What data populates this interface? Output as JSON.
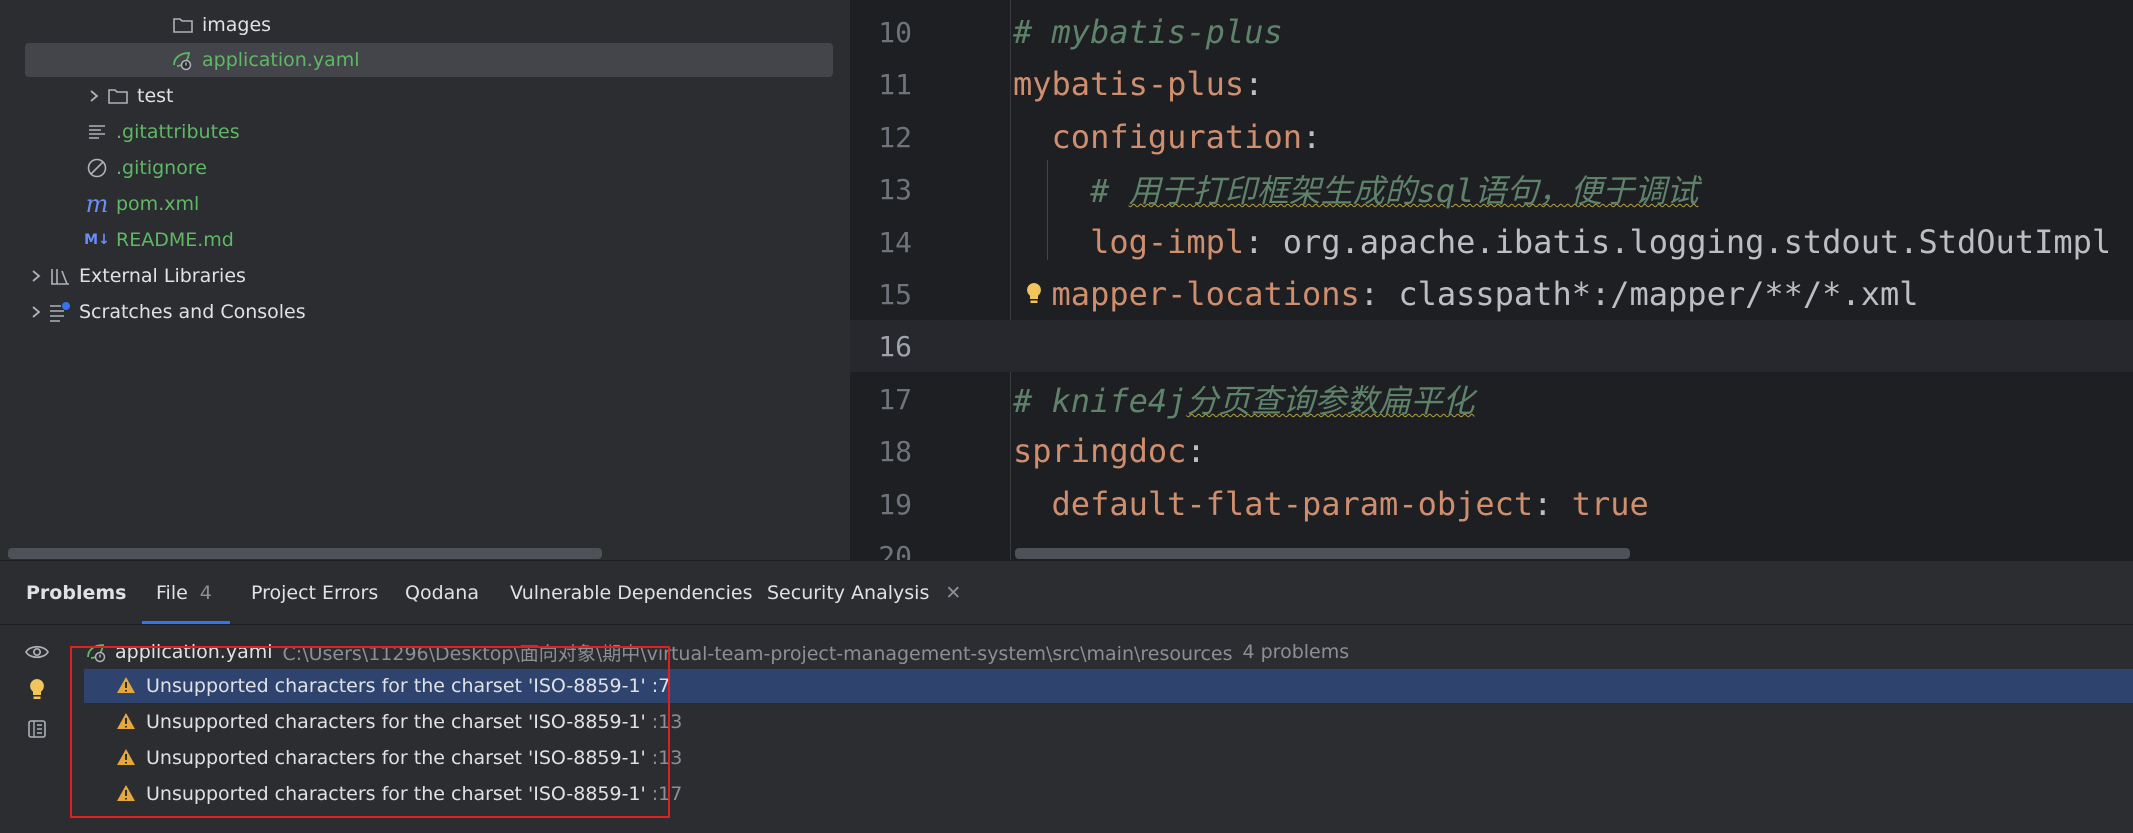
{
  "project_tree": {
    "items": [
      {
        "label": "images",
        "icon": "folder-icon",
        "color": "#dfe1e5"
      },
      {
        "label": "application.yaml",
        "icon": "spring-config-icon",
        "color": "#5fb865"
      },
      {
        "label": "test",
        "icon": "folder-icon",
        "color": "#dfe1e5"
      },
      {
        "label": ".gitattributes",
        "icon": "text-file-icon",
        "color": "#5fb865"
      },
      {
        "label": ".gitignore",
        "icon": "ignore-file-icon",
        "color": "#5fb865"
      },
      {
        "label": "pom.xml",
        "icon": "maven-icon",
        "color": "#5fb865"
      },
      {
        "label": "README.md",
        "icon": "markdown-icon",
        "color": "#5fb865"
      },
      {
        "label": "External Libraries",
        "icon": "libraries-icon",
        "color": "#dfe1e5"
      },
      {
        "label": "Scratches and Consoles",
        "icon": "scratches-icon",
        "color": "#dfe1e5"
      }
    ]
  },
  "editor": {
    "current_line": "16",
    "lines": [
      {
        "num": "10",
        "parts": [
          {
            "t": "# mybatis-plus",
            "c": "comment"
          }
        ]
      },
      {
        "num": "11",
        "parts": [
          {
            "t": "mybatis-plus",
            "c": "key"
          },
          {
            "t": ":",
            "c": "plain"
          }
        ]
      },
      {
        "num": "12",
        "parts": [
          {
            "t": "  configuration",
            "c": "key"
          },
          {
            "t": ":",
            "c": "plain"
          }
        ]
      },
      {
        "num": "13",
        "parts": [
          {
            "t": "    # ",
            "c": "comment"
          },
          {
            "t": "用于打印框架生成的sql语句，便于调试",
            "c": "comment-squig"
          }
        ]
      },
      {
        "num": "14",
        "parts": [
          {
            "t": "    log-impl",
            "c": "key"
          },
          {
            "t": ": org.apache.ibatis.logging.stdout.StdOutImpl",
            "c": "plain"
          }
        ]
      },
      {
        "num": "15",
        "parts": [
          {
            "t": "  mapper-locations",
            "c": "key"
          },
          {
            "t": ": classpath*:/mapper/**/*.xml",
            "c": "plain"
          }
        ]
      },
      {
        "num": "16",
        "parts": []
      },
      {
        "num": "17",
        "parts": [
          {
            "t": "# knife4j",
            "c": "comment"
          },
          {
            "t": "分页查询参数扁平化",
            "c": "comment-squig"
          }
        ]
      },
      {
        "num": "18",
        "parts": [
          {
            "t": "springdoc",
            "c": "key"
          },
          {
            "t": ":",
            "c": "plain"
          }
        ]
      },
      {
        "num": "19",
        "parts": [
          {
            "t": "  default-flat-param-object",
            "c": "key"
          },
          {
            "t": ": ",
            "c": "plain"
          },
          {
            "t": "true",
            "c": "key"
          }
        ]
      },
      {
        "num": "20",
        "parts": []
      }
    ]
  },
  "problems": {
    "tabs": [
      {
        "label": "Problems",
        "count": ""
      },
      {
        "label": "File",
        "count": "4"
      },
      {
        "label": "Project Errors",
        "count": ""
      },
      {
        "label": "Qodana",
        "count": ""
      },
      {
        "label": "Vulnerable Dependencies",
        "count": ""
      },
      {
        "label": "Security Analysis",
        "count": ""
      }
    ],
    "file": {
      "name": "application.yaml",
      "path": "C:\\Users\\11296\\Desktop\\面向对象\\期中\\virtual-team-project-management-system\\src\\main\\resources",
      "summary": "4 problems"
    },
    "items": [
      {
        "message": "Unsupported characters for the charset 'ISO-8859-1'",
        "line": ":7"
      },
      {
        "message": "Unsupported characters for the charset 'ISO-8859-1'",
        "line": ":13"
      },
      {
        "message": "Unsupported characters for the charset 'ISO-8859-1'",
        "line": ":13"
      },
      {
        "message": "Unsupported characters for the charset 'ISO-8859-1'",
        "line": ":17"
      }
    ]
  },
  "colors": {
    "accent": "#3574f0",
    "selection": "#2e436e",
    "warning": "#e5a63c",
    "highlight_box": "#e02020"
  }
}
